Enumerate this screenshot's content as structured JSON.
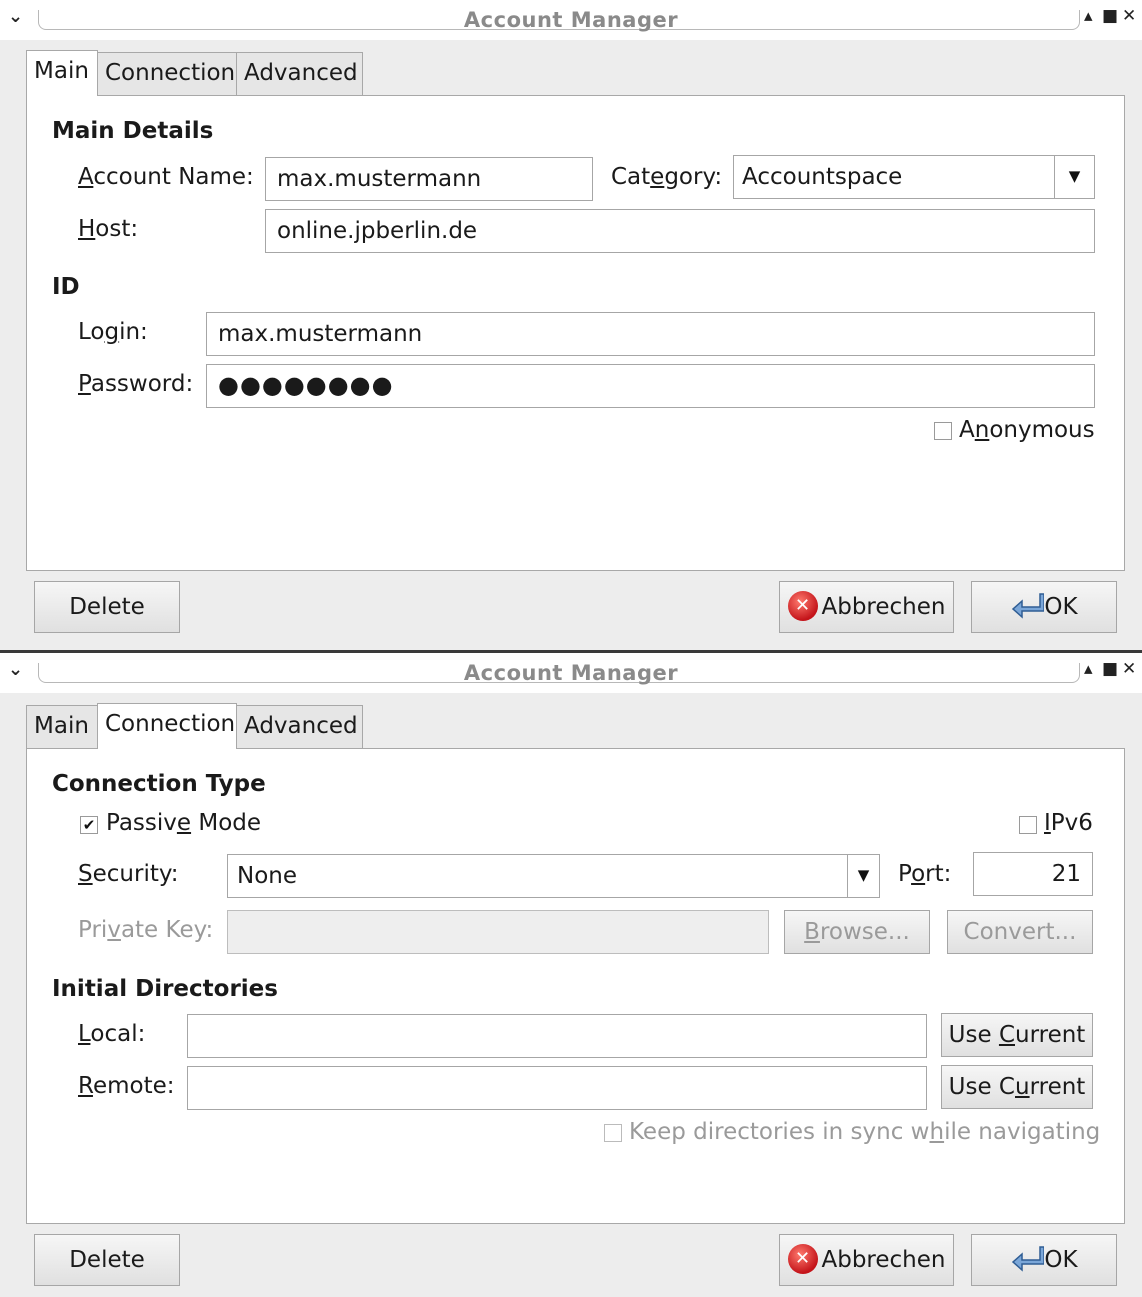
{
  "window_title": "Account Manager",
  "tabs": [
    "Main",
    "Connection",
    "Advanced"
  ],
  "main": {
    "section_details": "Main Details",
    "account_name_label": "Account Name:",
    "account_name_value": "max.mustermann",
    "category_label": "Category:",
    "category_value": "Accountspace",
    "host_label": "Host:",
    "host_value": "online.jpberlin.de",
    "section_id": "ID",
    "login_label": "Login:",
    "login_value": "max.mustermann",
    "password_label": "Password:",
    "password_value": "●●●●●●●●",
    "anonymous_label": "Anonymous",
    "anonymous_checked": false
  },
  "connection": {
    "section_type": "Connection Type",
    "passive_label": "Passive Mode",
    "passive_checked": true,
    "ipv6_label": "IPv6",
    "ipv6_checked": false,
    "security_label": "Security:",
    "security_value": "None",
    "port_label": "Port:",
    "port_value": "21",
    "private_key_label": "Private Key:",
    "private_key_value": "",
    "browse_label": "Browse...",
    "convert_label": "Convert...",
    "section_dirs": "Initial Directories",
    "local_label": "Local:",
    "local_value": "",
    "remote_label": "Remote:",
    "remote_value": "",
    "use_current_label": "Use Current",
    "sync_label": "Keep directories in sync while navigating",
    "sync_checked": false
  },
  "buttons": {
    "delete": "Delete",
    "cancel": "Abbrechen",
    "ok": "OK"
  },
  "icons": {
    "window_menu": "chevron-down-icon",
    "window_controls": [
      "maximize-up-icon",
      "restore-icon",
      "close-icon"
    ],
    "cancel": "cancel-icon",
    "ok": "ok-icon"
  }
}
